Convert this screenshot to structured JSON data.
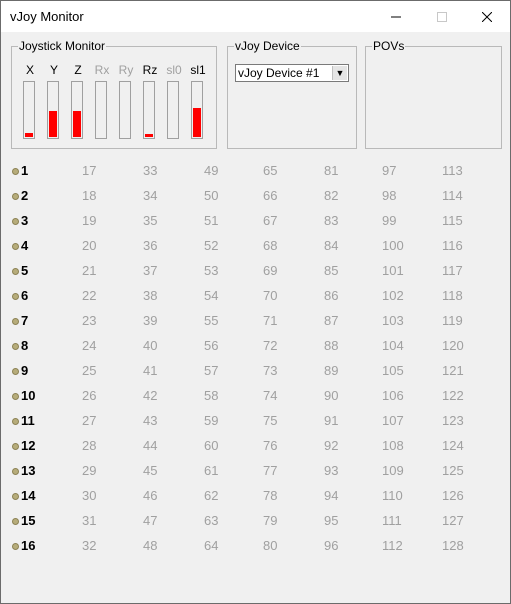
{
  "window": {
    "title": "vJoy Monitor"
  },
  "joystick_monitor": {
    "title": "Joystick Monitor",
    "axes": [
      {
        "label": "X",
        "active": true,
        "fill": 0.08
      },
      {
        "label": "Y",
        "active": true,
        "fill": 0.47
      },
      {
        "label": "Z",
        "active": true,
        "fill": 0.47
      },
      {
        "label": "Rx",
        "active": false,
        "fill": 0
      },
      {
        "label": "Ry",
        "active": false,
        "fill": 0
      },
      {
        "label": "Rz",
        "active": true,
        "fill": 0.05
      },
      {
        "label": "sl0",
        "active": false,
        "fill": 0
      },
      {
        "label": "sl1",
        "active": true,
        "fill": 0.52
      }
    ]
  },
  "vjoy_device": {
    "title": "vJoy Device",
    "selected": "vJoy Device #1"
  },
  "povs": {
    "title": "POVs"
  },
  "buttons": {
    "columns": [
      [
        "1",
        "2",
        "3",
        "4",
        "5",
        "6",
        "7",
        "8",
        "9",
        "10",
        "11",
        "12",
        "13",
        "14",
        "15",
        "16"
      ],
      [
        "17",
        "18",
        "19",
        "20",
        "21",
        "22",
        "23",
        "24",
        "25",
        "26",
        "27",
        "28",
        "29",
        "30",
        "31",
        "32"
      ],
      [
        "33",
        "34",
        "35",
        "36",
        "37",
        "38",
        "39",
        "40",
        "41",
        "42",
        "43",
        "44",
        "45",
        "46",
        "47",
        "48"
      ],
      [
        "49",
        "50",
        "51",
        "52",
        "53",
        "54",
        "55",
        "56",
        "57",
        "58",
        "59",
        "60",
        "61",
        "62",
        "63",
        "64"
      ],
      [
        "65",
        "66",
        "67",
        "68",
        "69",
        "70",
        "71",
        "72",
        "73",
        "74",
        "75",
        "76",
        "77",
        "78",
        "79",
        "80"
      ],
      [
        "81",
        "82",
        "83",
        "84",
        "85",
        "86",
        "87",
        "88",
        "89",
        "90",
        "91",
        "92",
        "93",
        "94",
        "95",
        "96"
      ],
      [
        "97",
        "98",
        "99",
        "100",
        "101",
        "102",
        "103",
        "104",
        "105",
        "106",
        "107",
        "108",
        "109",
        "110",
        "111",
        "112"
      ],
      [
        "113",
        "114",
        "115",
        "116",
        "117",
        "118",
        "119",
        "120",
        "121",
        "122",
        "123",
        "124",
        "125",
        "126",
        "127",
        "128"
      ]
    ]
  }
}
